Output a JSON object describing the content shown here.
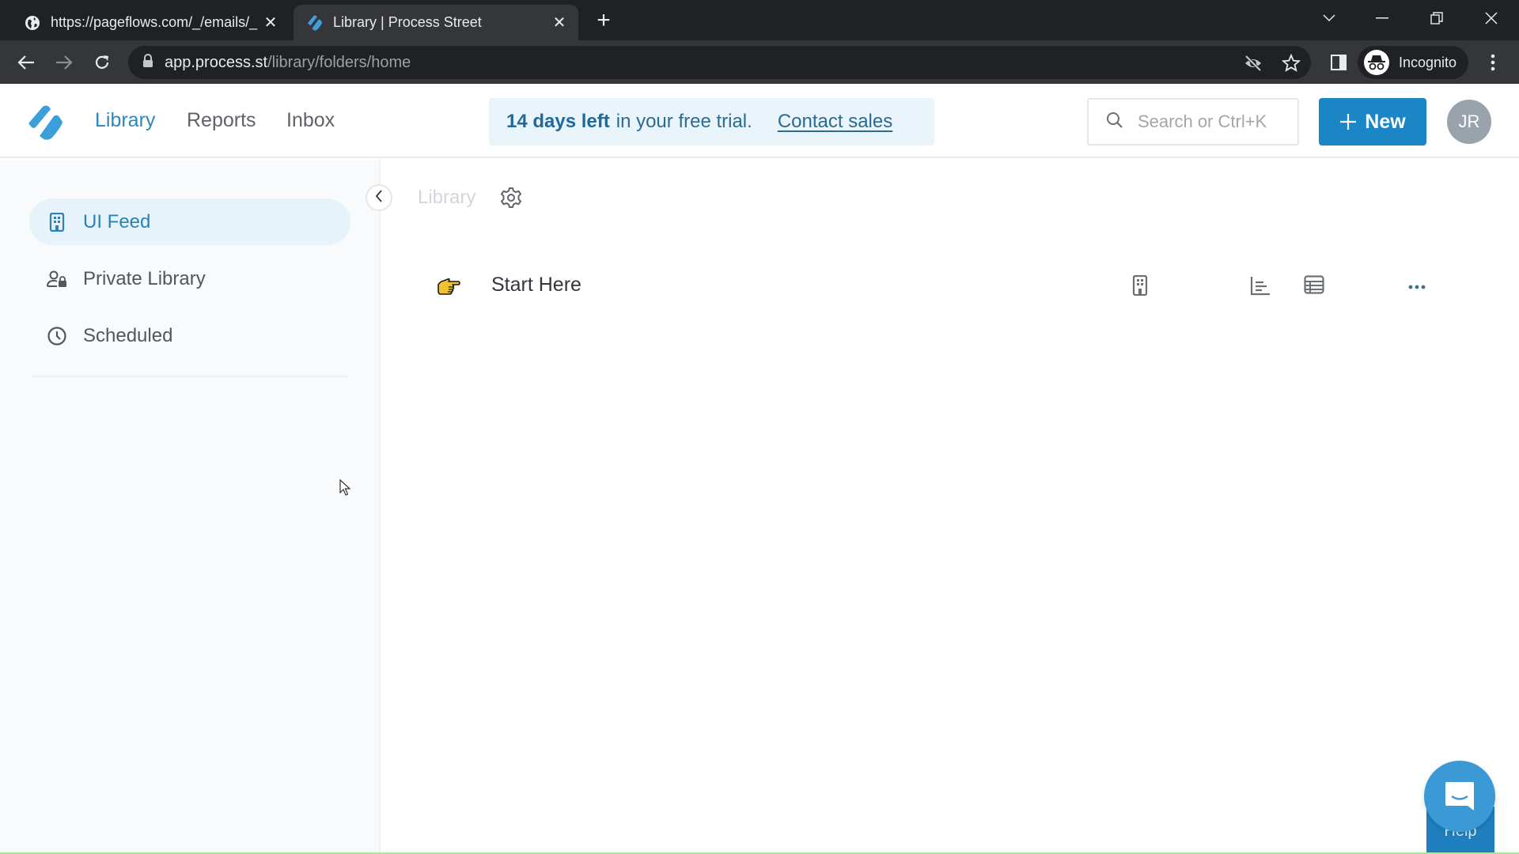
{
  "browser": {
    "tabs": [
      {
        "title": "https://pageflows.com/_/emails/_",
        "active": false,
        "icon": "globe-icon"
      },
      {
        "title": "Library | Process Street",
        "active": true,
        "icon": "process-street-favicon"
      }
    ],
    "url_host": "app.process.st",
    "url_path": "/library/folders/home",
    "profile_label": "Incognito"
  },
  "header": {
    "nav": [
      {
        "label": "Library",
        "active": true
      },
      {
        "label": "Reports",
        "active": false
      },
      {
        "label": "Inbox",
        "active": false
      }
    ],
    "trial": {
      "days_left": "14 days left",
      "rest": "in your free trial.",
      "cta": "Contact sales"
    },
    "search_placeholder": "Search or Ctrl+K",
    "new_button": "New",
    "avatar_initials": "JR"
  },
  "sidebar": {
    "items": [
      {
        "label": "UI Feed",
        "icon": "building-icon",
        "active": true
      },
      {
        "label": "Private Library",
        "icon": "user-lock-icon",
        "active": false
      },
      {
        "label": "Scheduled",
        "icon": "clock-icon",
        "active": false
      }
    ]
  },
  "main": {
    "breadcrumb": "Library",
    "rows": [
      {
        "emoji": "backhand-index-pointing-right",
        "name": "Start Here"
      }
    ]
  },
  "help": {
    "label": "Help"
  },
  "colors": {
    "brand": "#1a86c5",
    "active_nav": "#2a87c2",
    "trial_bg": "#e9f4fb",
    "sidebar_active_bg": "#e6f3fa"
  }
}
